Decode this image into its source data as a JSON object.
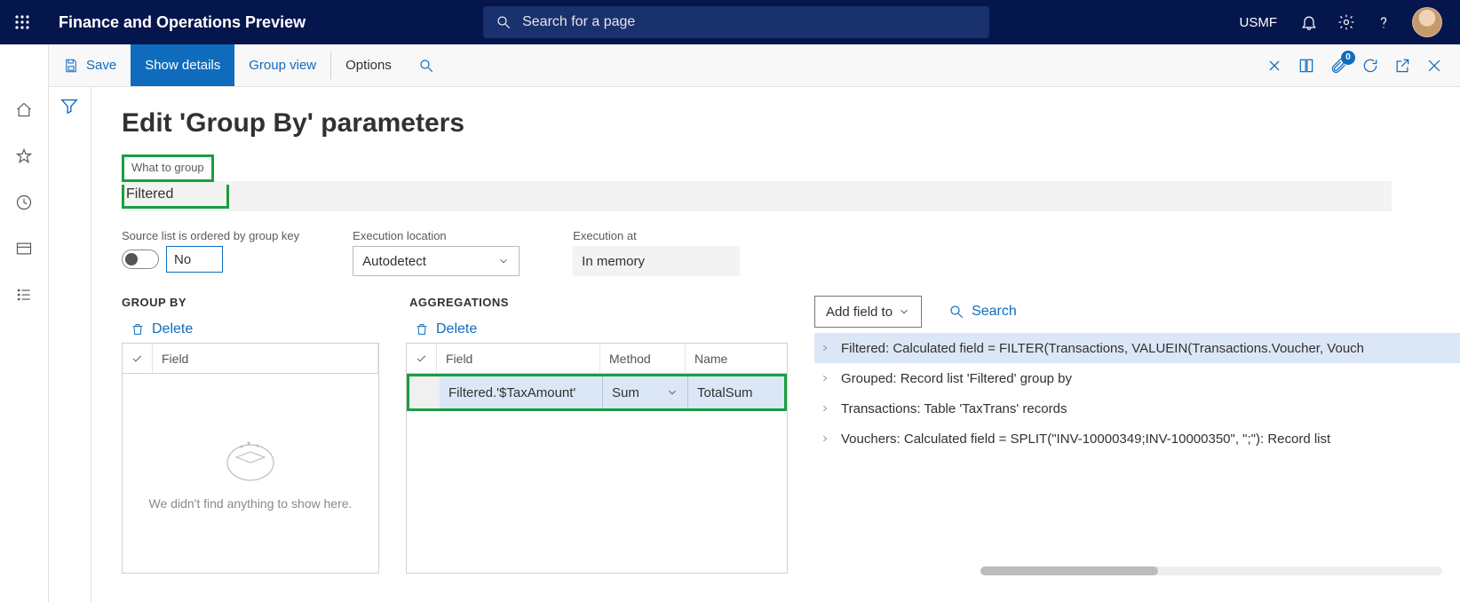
{
  "topbar": {
    "app_title": "Finance and Operations Preview",
    "search_placeholder": "Search for a page",
    "company": "USMF"
  },
  "actionbar": {
    "save": "Save",
    "show_details": "Show details",
    "group_view": "Group view",
    "options": "Options",
    "attach_count": "0"
  },
  "page": {
    "title": "Edit 'Group By' parameters",
    "what_to_group_label": "What to group",
    "what_to_group_value": "Filtered",
    "ordered_label": "Source list is ordered by group key",
    "ordered_value": "No",
    "exec_location_label": "Execution location",
    "exec_location_value": "Autodetect",
    "exec_at_label": "Execution at",
    "exec_at_value": "In memory"
  },
  "groupby": {
    "heading": "GROUP BY",
    "delete": "Delete",
    "col_field": "Field",
    "empty_msg": "We didn't find anything to show here."
  },
  "agg": {
    "heading": "AGGREGATIONS",
    "delete": "Delete",
    "col_field": "Field",
    "col_method": "Method",
    "col_name": "Name",
    "row": {
      "field": "Filtered.'$TaxAmount'",
      "method": "Sum",
      "name": "TotalSum"
    }
  },
  "tree": {
    "add_field": "Add field to",
    "search": "Search",
    "items": [
      "Filtered: Calculated field = FILTER(Transactions, VALUEIN(Transactions.Voucher, Vouch",
      "Grouped: Record list 'Filtered' group by",
      "Transactions: Table 'TaxTrans' records",
      "Vouchers: Calculated field = SPLIT(\"INV-10000349;INV-10000350\", \";\"): Record list"
    ]
  }
}
